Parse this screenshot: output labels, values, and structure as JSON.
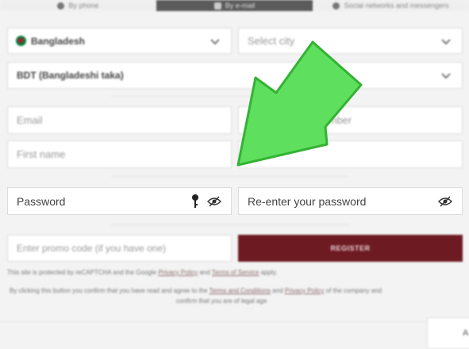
{
  "tabs": [
    {
      "label": "By phone"
    },
    {
      "label": "By e-mail"
    },
    {
      "label": "Social networks and messengers"
    }
  ],
  "form": {
    "country": "Bangladesh",
    "city_placeholder": "Select city",
    "currency": "BDT (Bangladeshi taka)",
    "email_placeholder": "Email",
    "phone_placeholder": "Number",
    "first_name_placeholder": "First name",
    "password_placeholder": "Password",
    "reenter_password_placeholder": "Re-enter your password",
    "promo_placeholder": "Enter promo code (if you have one)",
    "register_label": "REGISTER"
  },
  "legal": {
    "recaptcha_prefix": "This site is protected by reCAPTCHA and the Google",
    "privacy_policy": "Privacy Policy",
    "and": "and",
    "terms_of_service": "Terms of Service",
    "apply": "apply.",
    "confirm_prefix": "By clicking this button you confirm that you have read and agree to the",
    "terms_and_conditions": "Terms and Conditions",
    "and2": "and",
    "privacy_policy2": "Privacy Policy",
    "confirm_suffix": "of the company and",
    "confirm_line2": "confirm that you are of legal age"
  },
  "corner": {
    "label": "A"
  },
  "colors": {
    "register": "#6e1a22",
    "arrow": "#5ee05e",
    "arrow_edge": "#34b234"
  }
}
